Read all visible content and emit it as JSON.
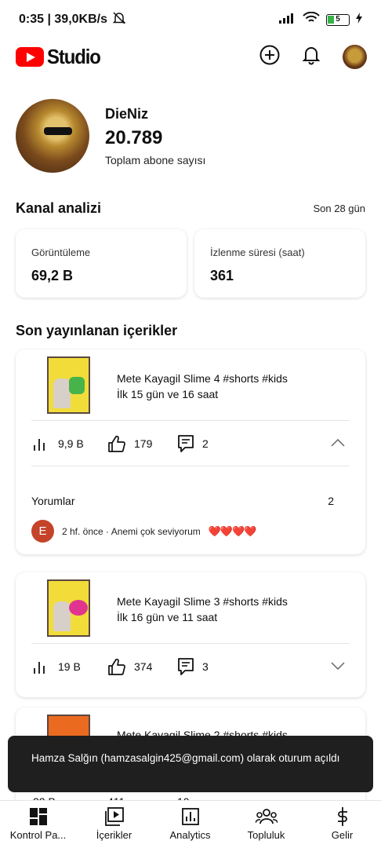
{
  "status_bar": {
    "time_speed": "0:35 | 39,0KB/s",
    "battery": "5"
  },
  "header": {
    "logo_text": "Studio"
  },
  "channel": {
    "name": "DieNiz",
    "subscriber_count": "20.789",
    "subscriber_label": "Toplam abone sayısı"
  },
  "analytics": {
    "title": "Kanal analizi",
    "period": "Son 28 gün",
    "metrics": [
      {
        "label": "Görüntüleme",
        "value": "69,2 B"
      },
      {
        "label": "İzlenme süresi (saat)",
        "value": "361"
      }
    ]
  },
  "recent": {
    "title": "Son yayınlanan içerikler",
    "videos": [
      {
        "title": "Mete Kayagil Slime 4 #shorts #kids",
        "age": "İlk 15 gün ve 16 saat",
        "views": "9,9 B",
        "likes": "179",
        "comments": "2",
        "expanded": true,
        "comments_label": "Yorumlar",
        "comments_count": "2",
        "latest_comment": {
          "initial": "E",
          "text": "2 hf. önce · Anemi çok seviyorum",
          "emoji": "❤️❤️❤️❤️"
        }
      },
      {
        "title": "Mete Kayagil Slime 3 #shorts #kids",
        "age": "İlk 16 gün ve 11 saat",
        "views": "19 B",
        "likes": "374",
        "comments": "3",
        "expanded": false
      },
      {
        "title": "Mete Kayagil Slime 2 #shorts #kids",
        "views": "22 B",
        "likes": "411",
        "comments": "10"
      }
    ]
  },
  "toast": {
    "message": "Hamza Salğın (hamzasalgin425@gmail.com) olarak oturum açıldı"
  },
  "bottom_nav": [
    {
      "label": "Kontrol Pa...",
      "icon": "dashboard-icon"
    },
    {
      "label": "İçerikler",
      "icon": "content-icon"
    },
    {
      "label": "Analytics",
      "icon": "analytics-icon"
    },
    {
      "label": "Topluluk",
      "icon": "community-icon"
    },
    {
      "label": "Gelir",
      "icon": "earn-icon"
    }
  ]
}
